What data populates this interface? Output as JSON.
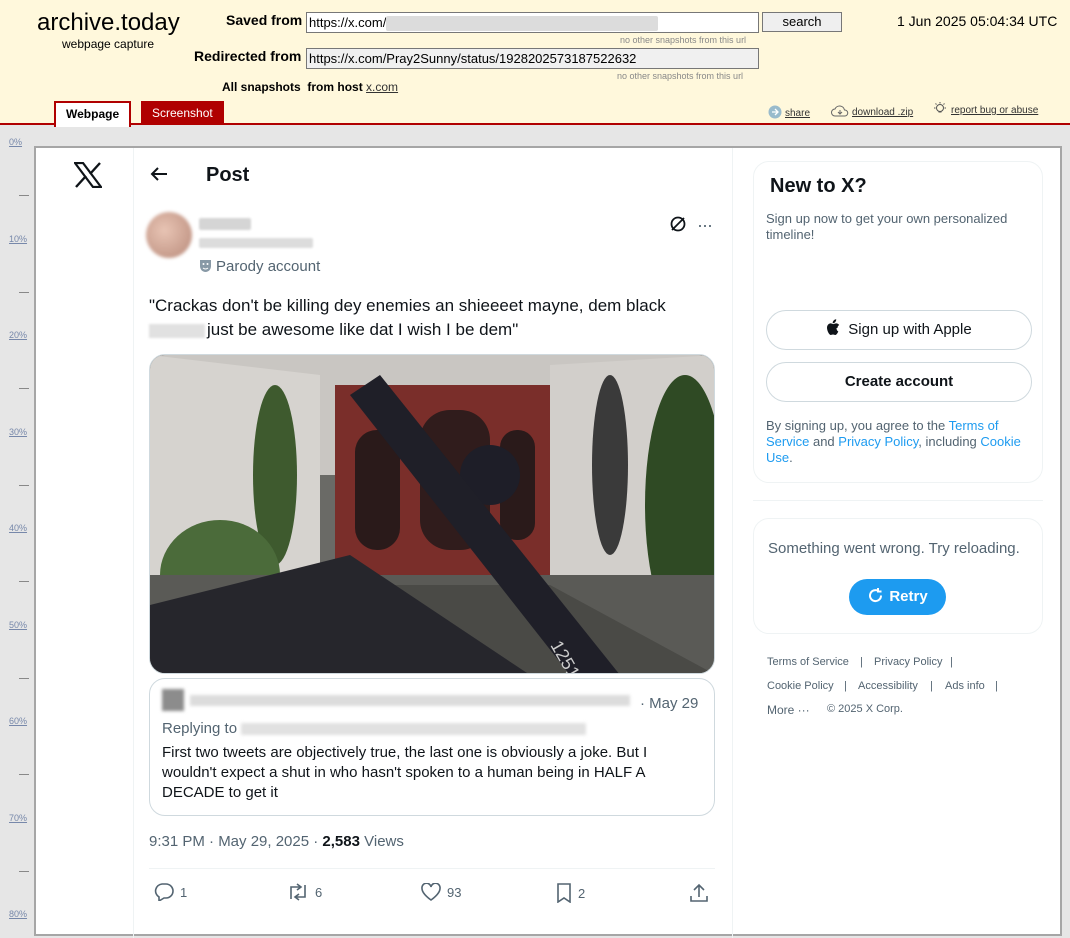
{
  "archive": {
    "logo": "archive.today",
    "subtitle": "webpage capture",
    "saved_label": "Saved from",
    "saved_url_prefix": "https://x.com/",
    "saved_note": "no other snapshots from this url",
    "search_label": "search",
    "date": "1 Jun 2025 05:04:34 UTC",
    "redirected_label": "Redirected from",
    "redirected_url": "https://x.com/Pray2Sunny/status/1928202573187522632",
    "redirected_note": "no other snapshots from this url",
    "all_snapshots_label": "All snapshots",
    "from_host_label": "from host",
    "host_link": "x.com",
    "tab_webpage": "Webpage",
    "tab_screenshot": "Screenshot",
    "action_share": "share",
    "action_download": "download .zip",
    "action_report": "report bug or abuse"
  },
  "ruler": {
    "labels": [
      "0%",
      "10%",
      "20%",
      "30%",
      "40%",
      "50%",
      "60%",
      "70%",
      "80%"
    ]
  },
  "page": {
    "title": "Post",
    "parody_label": "Parody account",
    "tweet_text_before": "\"Crackas don't be killing dey enemies an shieeeet mayne, dem black",
    "tweet_text_after": "just be awesome like dat I wish I be dem\"",
    "quote": {
      "date": "· May 29",
      "replying_to": "Replying to",
      "text": "First two tweets are objectively true, the last one is obviously a joke. But I wouldn't expect a shut in who hasn't spoken to a human being in HALF A DECADE to get it"
    },
    "timestamp": "9:31 PM · May 29, 2025 · ",
    "views_count": "2,583",
    "views_label": " Views",
    "actions": {
      "replies": "1",
      "reposts": "6",
      "likes": "93",
      "bookmarks": "2"
    },
    "sidebar": {
      "new_title": "New to X?",
      "new_subtitle": "Sign up now to get your own personalized timeline!",
      "apple_button": "Sign up with Apple",
      "create_button": "Create account",
      "terms_1": "By signing up, you agree to the ",
      "terms_link_1": "Terms of Service",
      "terms_2": " and ",
      "terms_link_2": "Privacy Policy",
      "terms_3": ", including ",
      "terms_link_3": "Cookie Use",
      "terms_4": ".",
      "error_text": "Something went wrong. Try reloading.",
      "retry_label": "Retry",
      "footer_links": [
        "Terms of Service",
        "Privacy Policy",
        "Cookie Policy",
        "Accessibility",
        "Ads info",
        "More ···",
        "© 2025 X Corp."
      ]
    }
  },
  "colors": {
    "archive_bg": "#fff8dc",
    "archive_red": "#b00000",
    "x_blue": "#1d9bf0",
    "x_text": "#0f1419",
    "x_muted": "#536471"
  }
}
